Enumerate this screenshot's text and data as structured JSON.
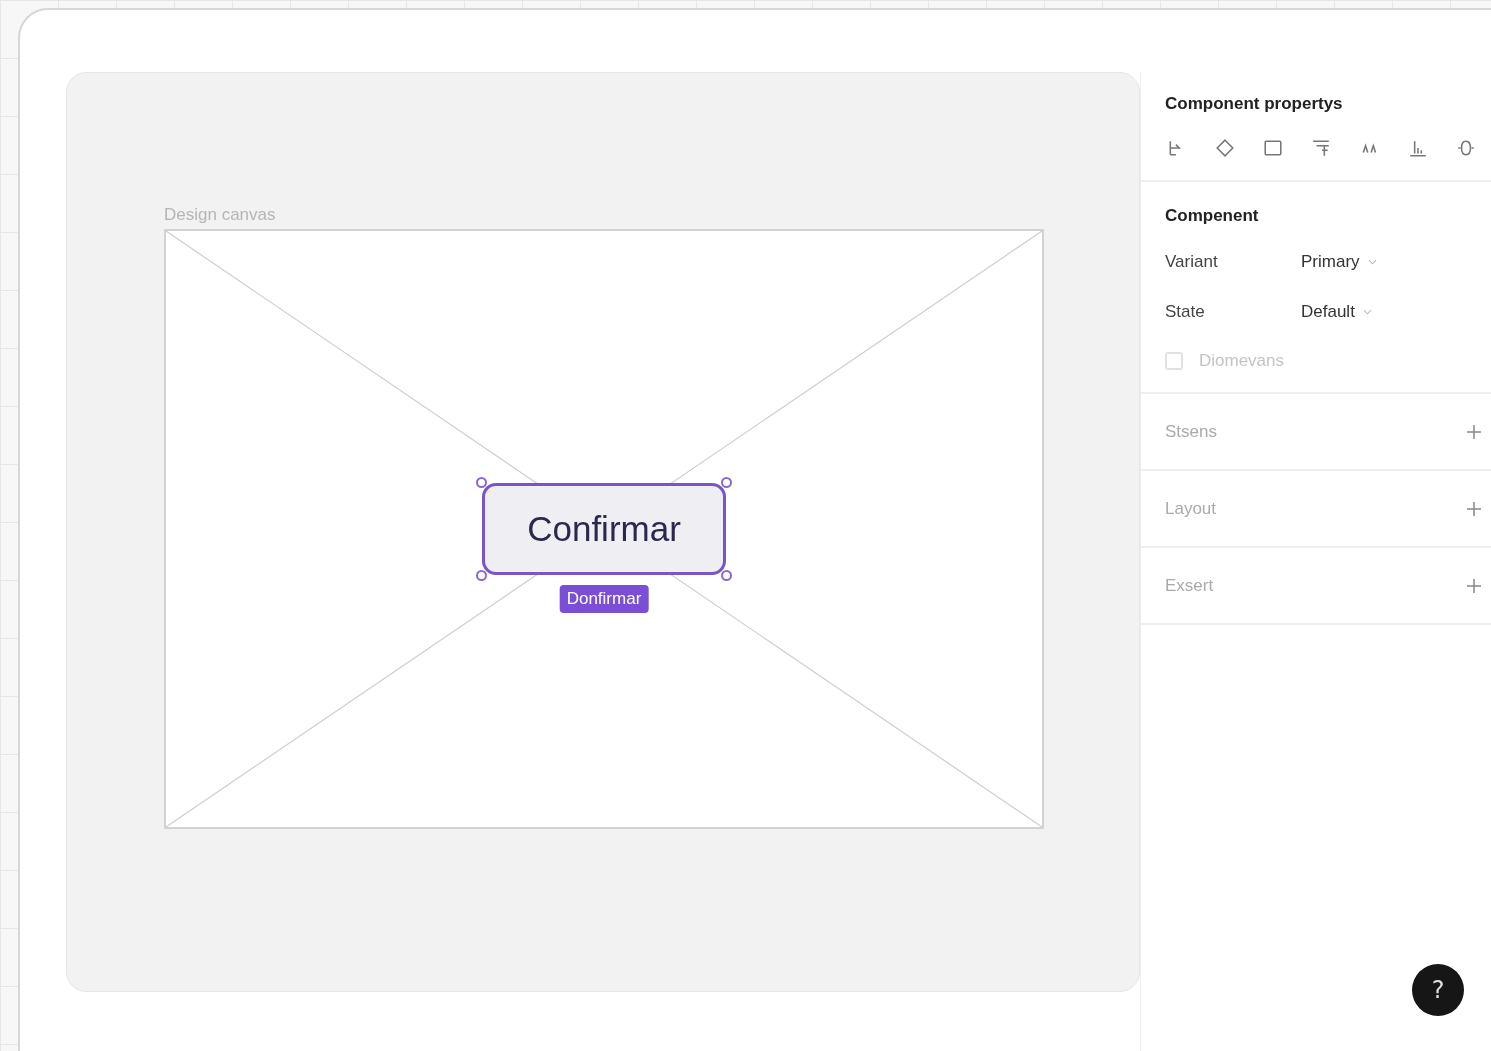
{
  "canvas": {
    "label": "Design canvas",
    "component": {
      "text": "Confirmar",
      "selected": true,
      "tag": "Donfirmar"
    }
  },
  "panel": {
    "title": "Component propertys",
    "component": {
      "title": "Compenent",
      "fields": [
        {
          "label": "Variant",
          "value": "Primary"
        },
        {
          "label": "State",
          "value": "Default"
        }
      ],
      "checkbox": {
        "label": "Diomevans",
        "checked": false,
        "disabled": true
      }
    },
    "sections": [
      {
        "title": "Stsens"
      },
      {
        "title": "Layout"
      },
      {
        "title": "Exsert"
      }
    ]
  },
  "help": {
    "label": "?"
  }
}
